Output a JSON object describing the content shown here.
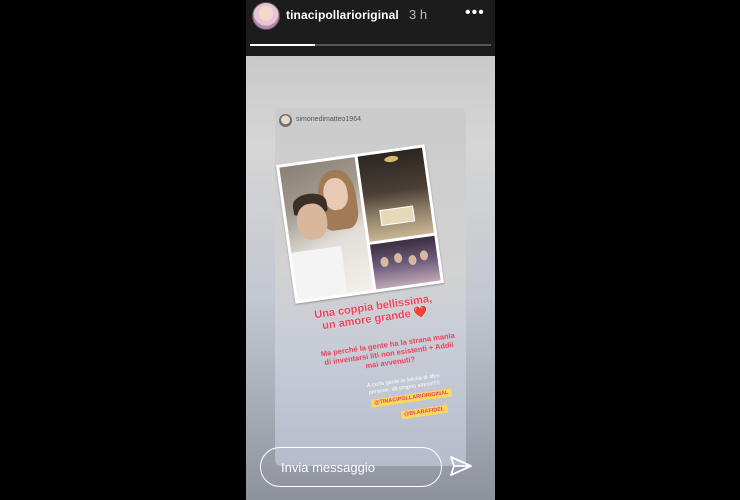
{
  "header": {
    "username": "tinacipollarioriginal",
    "time": "3 h",
    "more_icon": "more-horizontal-icon",
    "progress": 0.27
  },
  "reshared_post": {
    "username": "simonedimatteo1964",
    "caption_title": "Una coppia bellissima, un amore grande ❤️",
    "caption_sub": "Ma perché la gente ha la strana mania di inventarsi liti non esistenti + Addii mai avvenuti?",
    "caption_small": "A certa gente la felicità di altre persone, dà proprio stress!!!!!",
    "tags": [
      "@TINACIPOLLARIORIGINAL",
      "@BLARAFIDEL"
    ]
  },
  "footer": {
    "input_placeholder": "Invia messaggio",
    "send_icon": "send-icon"
  },
  "colors": {
    "caption_pink": "#e8445b",
    "tag_yellow": "#f9d860",
    "background": "#000000"
  }
}
